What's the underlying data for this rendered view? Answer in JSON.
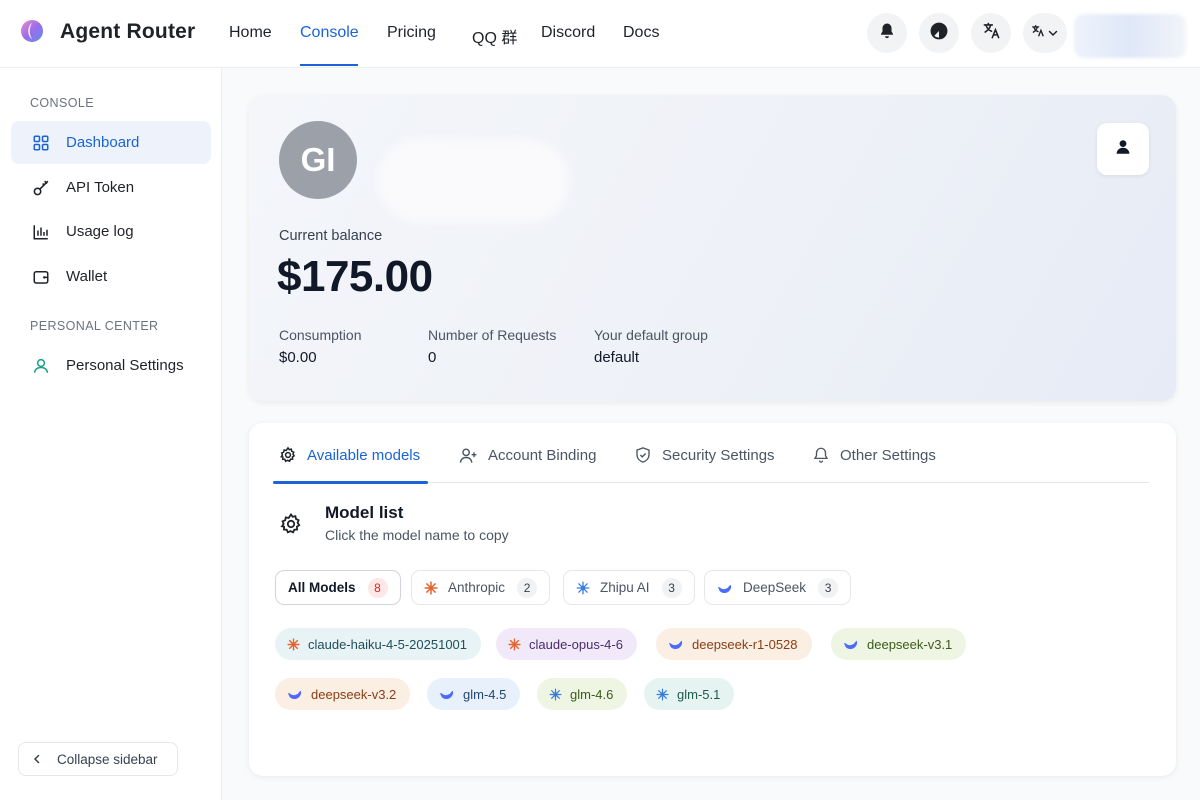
{
  "app": {
    "name": "Agent Router"
  },
  "nav": {
    "home": "Home",
    "console": "Console",
    "pricing": "Pricing",
    "qq": "QQ 群",
    "discord": "Discord",
    "docs": "Docs"
  },
  "sidebar": {
    "section_console": "CONSOLE",
    "dashboard": "Dashboard",
    "api_token": "API Token",
    "usage_log": "Usage log",
    "wallet": "Wallet",
    "section_personal": "PERSONAL CENTER",
    "personal_settings": "Personal Settings",
    "collapse": "Collapse sidebar"
  },
  "profile": {
    "initials": "GI",
    "balance_label": "Current balance",
    "balance": "$175.00",
    "consumption_label": "Consumption",
    "consumption": "$0.00",
    "requests_label": "Number of Requests",
    "requests": "0",
    "group_label": "Your default group",
    "group": "default"
  },
  "tabs": {
    "models": "Available models",
    "binding": "Account Binding",
    "security": "Security Settings",
    "other": "Other Settings"
  },
  "model_list": {
    "title": "Model list",
    "subtitle": "Click the model name to copy"
  },
  "filters": [
    {
      "label": "All Models",
      "count": "8"
    },
    {
      "label": "Anthropic",
      "count": "2"
    },
    {
      "label": "Zhipu AI",
      "count": "3"
    },
    {
      "label": "DeepSeek",
      "count": "3"
    }
  ],
  "models": [
    {
      "name": "claude-haiku-4-5-20251001",
      "icon": "anthropic-icon",
      "color": "#e8f3f5"
    },
    {
      "name": "claude-opus-4-6",
      "icon": "anthropic-icon",
      "color": "#f1e9f9"
    },
    {
      "name": "deepseek-r1-0528",
      "icon": "deepseek-icon",
      "color": "#fbeee2"
    },
    {
      "name": "deepseek-v3.1",
      "icon": "deepseek-icon",
      "color": "#eef5e2"
    },
    {
      "name": "deepseek-v3.2",
      "icon": "deepseek-icon",
      "color": "#fbeee2"
    },
    {
      "name": "glm-4.5",
      "icon": "deepseek-icon",
      "color": "#e8f1fb"
    },
    {
      "name": "glm-4.6",
      "icon": "zhipu-icon",
      "color": "#eef5e2"
    },
    {
      "name": "glm-5.1",
      "icon": "zhipu-icon",
      "color": "#e6f4f1"
    }
  ],
  "colors": {
    "accent": "#1a63d8",
    "anthropic": "#e4642f",
    "zhipu": "#3b7ddd",
    "deepseek": "#4d6bfe"
  }
}
